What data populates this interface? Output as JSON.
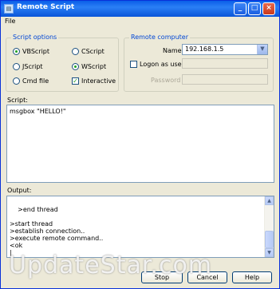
{
  "window": {
    "title": "Remote Script"
  },
  "menu": {
    "file": "File"
  },
  "script_options": {
    "legend": "Script options",
    "options": [
      "VBScript",
      "CScript",
      "JScript",
      "WScript",
      "Cmd file",
      "Interactive"
    ]
  },
  "remote_computer": {
    "legend": "Remote computer",
    "name_label": "Name",
    "name_value": "192.168.1.5",
    "logon_label": "Logon as user",
    "password_label": "Password"
  },
  "script": {
    "label": "Script:",
    "content": "msgbox \"HELLO!\""
  },
  "output": {
    "label": "Output:",
    "content": ">end thread\n\n>start thread\n>establish connection..\n>execute remote command..\n<ok\n|"
  },
  "buttons": {
    "stop": "Stop",
    "cancel": "Cancel",
    "help": "Help"
  },
  "watermark": "UpdateStar.com"
}
